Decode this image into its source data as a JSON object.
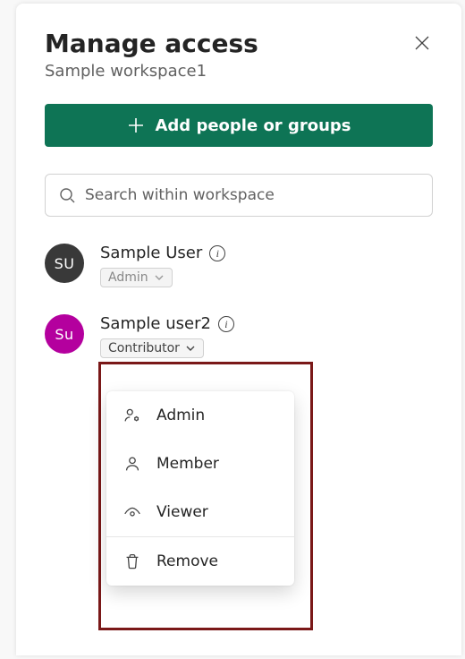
{
  "dialog": {
    "title": "Manage access",
    "subtitle": "Sample workspace1"
  },
  "addButton": {
    "label": "Add people or groups"
  },
  "search": {
    "placeholder": "Search within workspace"
  },
  "users": [
    {
      "initials": "SU",
      "name": "Sample User",
      "role": "Admin",
      "avatarColor": "dark",
      "roleLocked": true
    },
    {
      "initials": "Su",
      "name": "Sample user2",
      "role": "Contributor",
      "avatarColor": "mag",
      "roleLocked": false
    }
  ],
  "roleDropdown": {
    "options": [
      "Admin",
      "Member",
      "Viewer"
    ],
    "removeLabel": "Remove"
  }
}
